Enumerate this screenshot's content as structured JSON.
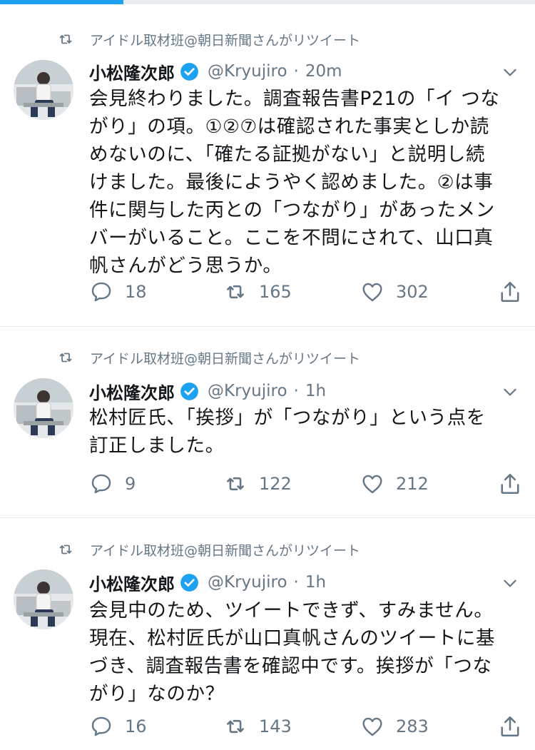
{
  "top_bar": {
    "progress_fraction": 0.23,
    "accent_color": "#1da1f2"
  },
  "colors": {
    "muted": "#657786",
    "text": "#14171a",
    "verified": "#1da1f2",
    "divider": "#e6ecf0"
  },
  "tweets": [
    {
      "retweet_label": "アイドル取材班@朝日新聞さんがリツイート",
      "name": "小松隆次郎",
      "handle": "@Kryujiro",
      "separator": "·",
      "time": "20m",
      "text": "会見終わりました。調査報告書P21の「イ つな\nがり」の項。①②⑦は確認された事実としか読\nめないのに、「確たる証拠がない」と説明し続\nけました。最後にようやく認めました。②は事\n件に関与した丙との「つながり」があったメン\nバーがいること。ここを不問にされて、山口真\n帆さんがどう思うか。",
      "replies": "18",
      "retweets": "165",
      "likes": "302"
    },
    {
      "retweet_label": "アイドル取材班@朝日新聞さんがリツイート",
      "name": "小松隆次郎",
      "handle": "@Kryujiro",
      "separator": "·",
      "time": "1h",
      "text": "松村匠氏、「挨拶」が「つながり」という点を\n訂正しました。",
      "replies": "9",
      "retweets": "122",
      "likes": "212"
    },
    {
      "retweet_label": "アイドル取材班@朝日新聞さんがリツイート",
      "name": "小松隆次郎",
      "handle": "@Kryujiro",
      "separator": "·",
      "time": "1h",
      "text": "会見中のため、ツイートできず、すみません。\n現在、松村匠氏が山口真帆さんのツイートに基\nづき、調査報告書を確認中です。挨拶が「つな\nがり」なのか？",
      "replies": "16",
      "retweets": "143",
      "likes": "283"
    }
  ]
}
